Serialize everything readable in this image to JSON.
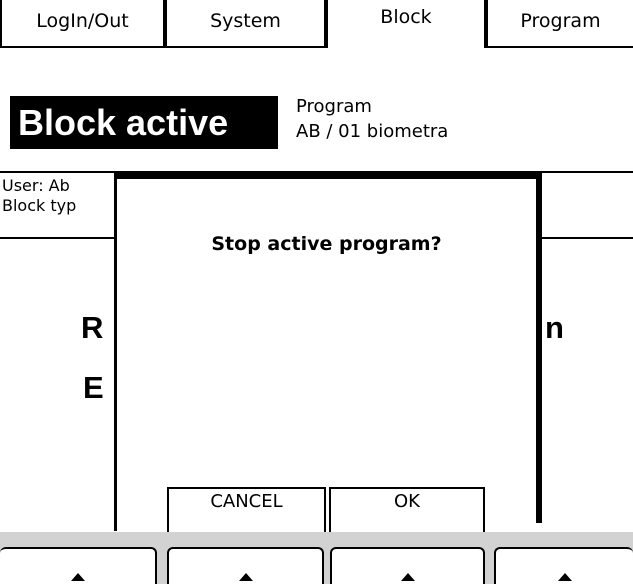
{
  "tabs": [
    {
      "label": "LogIn/Out"
    },
    {
      "label": "System"
    },
    {
      "label": "Block"
    },
    {
      "label": "Program"
    }
  ],
  "header": {
    "status": "Block active",
    "program_label": "Program",
    "program_name": "AB / 01 biometra"
  },
  "info": {
    "user_line": "User: Ab",
    "block_type_line": "Block typ"
  },
  "background_text": {
    "line1_left": "R",
    "line1_right": "n",
    "line2_left": "E"
  },
  "dialog": {
    "title": "Stop active program?",
    "cancel_label": "CANCEL",
    "ok_label": "OK"
  },
  "softkeys": [
    {
      "icon": "arrow-up-icon"
    },
    {
      "icon": "arrow-up-icon"
    },
    {
      "icon": "arrow-up-icon"
    },
    {
      "icon": "arrow-up-icon"
    }
  ]
}
